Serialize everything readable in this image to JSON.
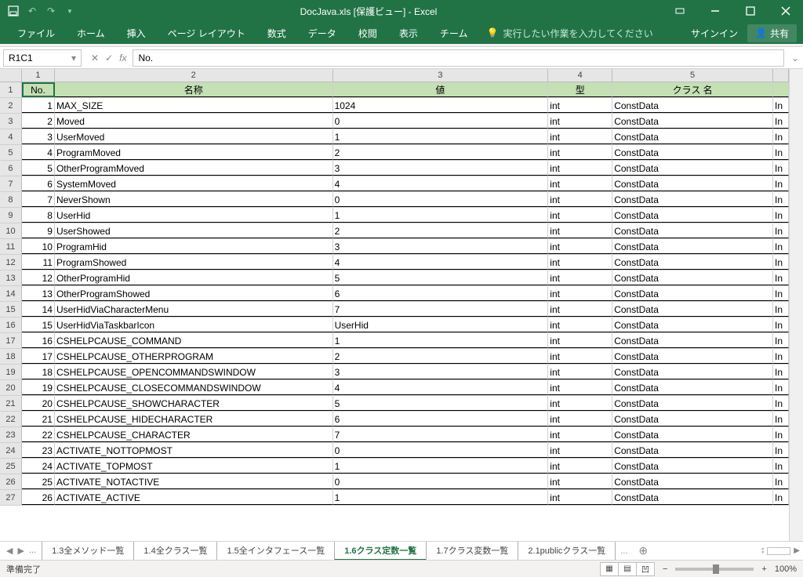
{
  "window": {
    "title": "DocJava.xls  [保護ビュー] - Excel"
  },
  "ribbon": {
    "tabs": [
      "ファイル",
      "ホーム",
      "挿入",
      "ページ レイアウト",
      "数式",
      "データ",
      "校閲",
      "表示",
      "チーム"
    ],
    "tellme": "実行したい作業を入力してください",
    "signin": "サインイン",
    "share": "共有"
  },
  "formula": {
    "namebox": "R1C1",
    "value": "No."
  },
  "columns": [
    {
      "num": "1",
      "w": "c1"
    },
    {
      "num": "2",
      "w": "c2"
    },
    {
      "num": "3",
      "w": "c3"
    },
    {
      "num": "4",
      "w": "c4"
    },
    {
      "num": "5",
      "w": "c5"
    },
    {
      "num": "",
      "w": "c6"
    }
  ],
  "headers": {
    "c1": "No.",
    "c2": "名称",
    "c3": "値",
    "c4": "型",
    "c5": "クラス 名",
    "c6": ""
  },
  "rows": [
    {
      "r": "2",
      "no": "1",
      "name": "MAX_SIZE",
      "val": "1024",
      "type": "int",
      "cls": "ConstData",
      "x": "In"
    },
    {
      "r": "3",
      "no": "2",
      "name": "Moved",
      "val": "0",
      "type": "int",
      "cls": "ConstData",
      "x": "In"
    },
    {
      "r": "4",
      "no": "3",
      "name": "UserMoved",
      "val": "1",
      "type": "int",
      "cls": "ConstData",
      "x": "In"
    },
    {
      "r": "5",
      "no": "4",
      "name": "ProgramMoved",
      "val": "2",
      "type": "int",
      "cls": "ConstData",
      "x": "In"
    },
    {
      "r": "6",
      "no": "5",
      "name": "OtherProgramMoved",
      "val": "3",
      "type": "int",
      "cls": "ConstData",
      "x": "In"
    },
    {
      "r": "7",
      "no": "6",
      "name": "SystemMoved",
      "val": "4",
      "type": "int",
      "cls": "ConstData",
      "x": "In"
    },
    {
      "r": "8",
      "no": "7",
      "name": "NeverShown",
      "val": "0",
      "type": "int",
      "cls": "ConstData",
      "x": "In"
    },
    {
      "r": "9",
      "no": "8",
      "name": "UserHid",
      "val": "1",
      "type": "int",
      "cls": "ConstData",
      "x": "In"
    },
    {
      "r": "10",
      "no": "9",
      "name": "UserShowed",
      "val": "2",
      "type": "int",
      "cls": "ConstData",
      "x": "In"
    },
    {
      "r": "11",
      "no": "10",
      "name": "ProgramHid",
      "val": "3",
      "type": "int",
      "cls": "ConstData",
      "x": "In"
    },
    {
      "r": "12",
      "no": "11",
      "name": "ProgramShowed",
      "val": "4",
      "type": "int",
      "cls": "ConstData",
      "x": "In"
    },
    {
      "r": "13",
      "no": "12",
      "name": "OtherProgramHid",
      "val": "5",
      "type": "int",
      "cls": "ConstData",
      "x": "In"
    },
    {
      "r": "14",
      "no": "13",
      "name": "OtherProgramShowed",
      "val": "6",
      "type": "int",
      "cls": "ConstData",
      "x": "In"
    },
    {
      "r": "15",
      "no": "14",
      "name": "UserHidViaCharacterMenu",
      "val": "7",
      "type": "int",
      "cls": "ConstData",
      "x": "In"
    },
    {
      "r": "16",
      "no": "15",
      "name": "UserHidViaTaskbarIcon",
      "val": "UserHid",
      "type": "int",
      "cls": "ConstData",
      "x": "In"
    },
    {
      "r": "17",
      "no": "16",
      "name": "CSHELPCAUSE_COMMAND",
      "val": "1",
      "type": "int",
      "cls": "ConstData",
      "x": "In"
    },
    {
      "r": "18",
      "no": "17",
      "name": "CSHELPCAUSE_OTHERPROGRAM",
      "val": "2",
      "type": "int",
      "cls": "ConstData",
      "x": "In"
    },
    {
      "r": "19",
      "no": "18",
      "name": "CSHELPCAUSE_OPENCOMMANDSWINDOW",
      "val": "3",
      "type": "int",
      "cls": "ConstData",
      "x": "In"
    },
    {
      "r": "20",
      "no": "19",
      "name": "CSHELPCAUSE_CLOSECOMMANDSWINDOW",
      "val": "4",
      "type": "int",
      "cls": "ConstData",
      "x": "In"
    },
    {
      "r": "21",
      "no": "20",
      "name": "CSHELPCAUSE_SHOWCHARACTER",
      "val": "5",
      "type": "int",
      "cls": "ConstData",
      "x": "In"
    },
    {
      "r": "22",
      "no": "21",
      "name": "CSHELPCAUSE_HIDECHARACTER",
      "val": "6",
      "type": "int",
      "cls": "ConstData",
      "x": "In"
    },
    {
      "r": "23",
      "no": "22",
      "name": "CSHELPCAUSE_CHARACTER",
      "val": "7",
      "type": "int",
      "cls": "ConstData",
      "x": "In"
    },
    {
      "r": "24",
      "no": "23",
      "name": "ACTIVATE_NOTTOPMOST",
      "val": "0",
      "type": "int",
      "cls": "ConstData",
      "x": "In"
    },
    {
      "r": "25",
      "no": "24",
      "name": "ACTIVATE_TOPMOST",
      "val": "1",
      "type": "int",
      "cls": "ConstData",
      "x": "In"
    },
    {
      "r": "26",
      "no": "25",
      "name": "ACTIVATE_NOTACTIVE",
      "val": "0",
      "type": "int",
      "cls": "ConstData",
      "x": "In"
    },
    {
      "r": "27",
      "no": "26",
      "name": "ACTIVATE_ACTIVE",
      "val": "1",
      "type": "int",
      "cls": "ConstData",
      "x": "In"
    }
  ],
  "sheets": {
    "overflow": "...",
    "tabs": [
      "1.3全メソッド一覧",
      "1.4全クラス一覧",
      "1.5全インタフェース一覧",
      "1.6クラス定数一覧",
      "1.7クラス変数一覧",
      "2.1publicクラス一覧"
    ],
    "active": "1.6クラス定数一覧",
    "more": "..."
  },
  "status": {
    "ready": "準備完了",
    "zoom": "100%"
  }
}
